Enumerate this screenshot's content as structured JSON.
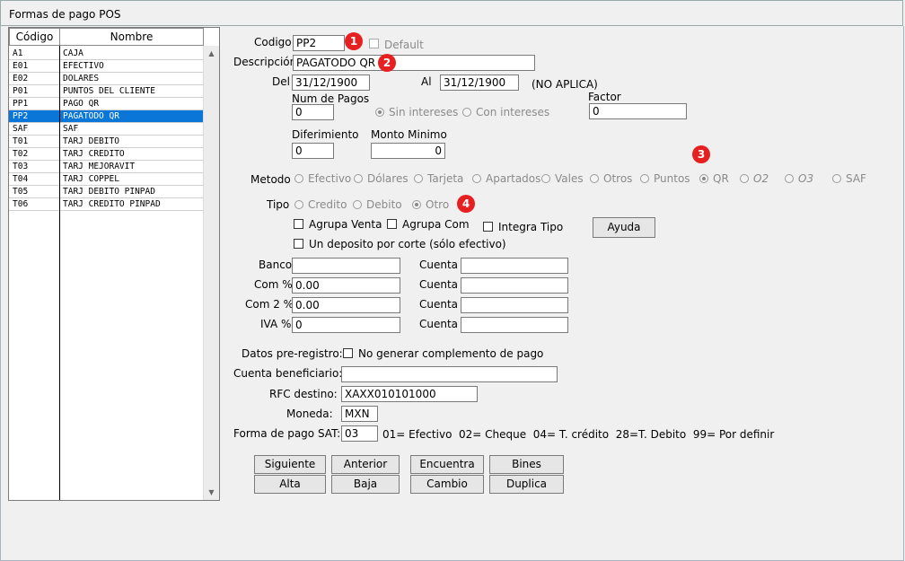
{
  "window": {
    "title": "Formas de pago POS"
  },
  "list": {
    "headers": {
      "codigo": "Código",
      "nombre": "Nombre"
    },
    "rows": [
      {
        "code": "A1",
        "name": "CAJA"
      },
      {
        "code": "E01",
        "name": "EFECTIVO"
      },
      {
        "code": "E02",
        "name": "DOLARES"
      },
      {
        "code": "P01",
        "name": "PUNTOS DEL CLIENTE"
      },
      {
        "code": "PP1",
        "name": "PAGO QR"
      },
      {
        "code": "PP2",
        "name": "PAGATODO QR"
      },
      {
        "code": "SAF",
        "name": "SAF"
      },
      {
        "code": "T01",
        "name": "TARJ DEBITO"
      },
      {
        "code": "T02",
        "name": "TARJ CREDITO"
      },
      {
        "code": "T03",
        "name": "TARJ MEJORAVIT"
      },
      {
        "code": "T04",
        "name": "TARJ COPPEL"
      },
      {
        "code": "T05",
        "name": "TARJ DEBITO PINPAD"
      },
      {
        "code": "T06",
        "name": "TARJ CREDITO PINPAD"
      }
    ],
    "selected": "PP2"
  },
  "form": {
    "codigo": {
      "label": "Codigo",
      "value": "PP2"
    },
    "default": {
      "label": "Default",
      "checked": false
    },
    "descripcion": {
      "label": "Descripción",
      "value": "PAGATODO QR"
    },
    "del": {
      "label": "Del",
      "value": "31/12/1900"
    },
    "al": {
      "label": "Al",
      "value": "31/12/1900"
    },
    "no_aplica": "(NO APLICA)",
    "num_pagos": {
      "label": "Num de Pagos",
      "value": "0"
    },
    "sin_intereses": "Sin intereses",
    "con_intereses": "Con intereses",
    "factor": {
      "label": "Factor",
      "value": "0"
    },
    "diferimiento": {
      "label": "Diferimiento",
      "value": "0"
    },
    "monto_minimo": {
      "label": "Monto Minimo",
      "value": "0"
    },
    "metodo": {
      "label": "Metodo",
      "options": [
        "Efectivo",
        "Dólares",
        "Tarjeta",
        "Apartados",
        "Vales",
        "Otros",
        "Puntos",
        "QR",
        "O2",
        "O3",
        "SAF"
      ],
      "selected": "QR"
    },
    "tipo": {
      "label": "Tipo",
      "options": [
        "Credito",
        "Debito",
        "Otro"
      ],
      "selected": "Otro"
    },
    "agrupa_venta": "Agrupa Venta",
    "agrupa_com": "Agrupa Com",
    "integra_tipo": "Integra Tipo",
    "ayuda": "Ayuda",
    "deposito": "Un deposito por corte (sólo efectivo)",
    "banco": {
      "label": "Banco",
      "value": ""
    },
    "com": {
      "label": "Com %",
      "value": "0.00"
    },
    "com2": {
      "label": "Com 2 %",
      "value": "0.00"
    },
    "iva": {
      "label": "IVA %",
      "value": "0"
    },
    "cuenta_label": "Cuenta",
    "datos_pre": "Datos pre-registro:",
    "no_generar": "No generar complemento de pago",
    "cuenta_benef": {
      "label": "Cuenta beneficiario:",
      "value": ""
    },
    "rfc": {
      "label": "RFC destino:",
      "value": "XAXX010101000"
    },
    "moneda": {
      "label": "Moneda:",
      "value": "MXN"
    },
    "forma_sat": {
      "label": "Forma de pago SAT:",
      "value": "03"
    },
    "sat_legend": "01= Efectivo  02= Cheque  04= T. crédito  28=T. Debito  99= Por definir"
  },
  "buttons": {
    "siguiente": "Siguiente",
    "anterior": "Anterior",
    "encuentra": "Encuentra",
    "bines": "Bines",
    "alta": "Alta",
    "baja": "Baja",
    "cambio": "Cambio",
    "duplica": "Duplica"
  },
  "badges": [
    "1",
    "2",
    "3",
    "4"
  ],
  "colors": {
    "selection": "#0a76d8",
    "badge": "#e62020"
  }
}
